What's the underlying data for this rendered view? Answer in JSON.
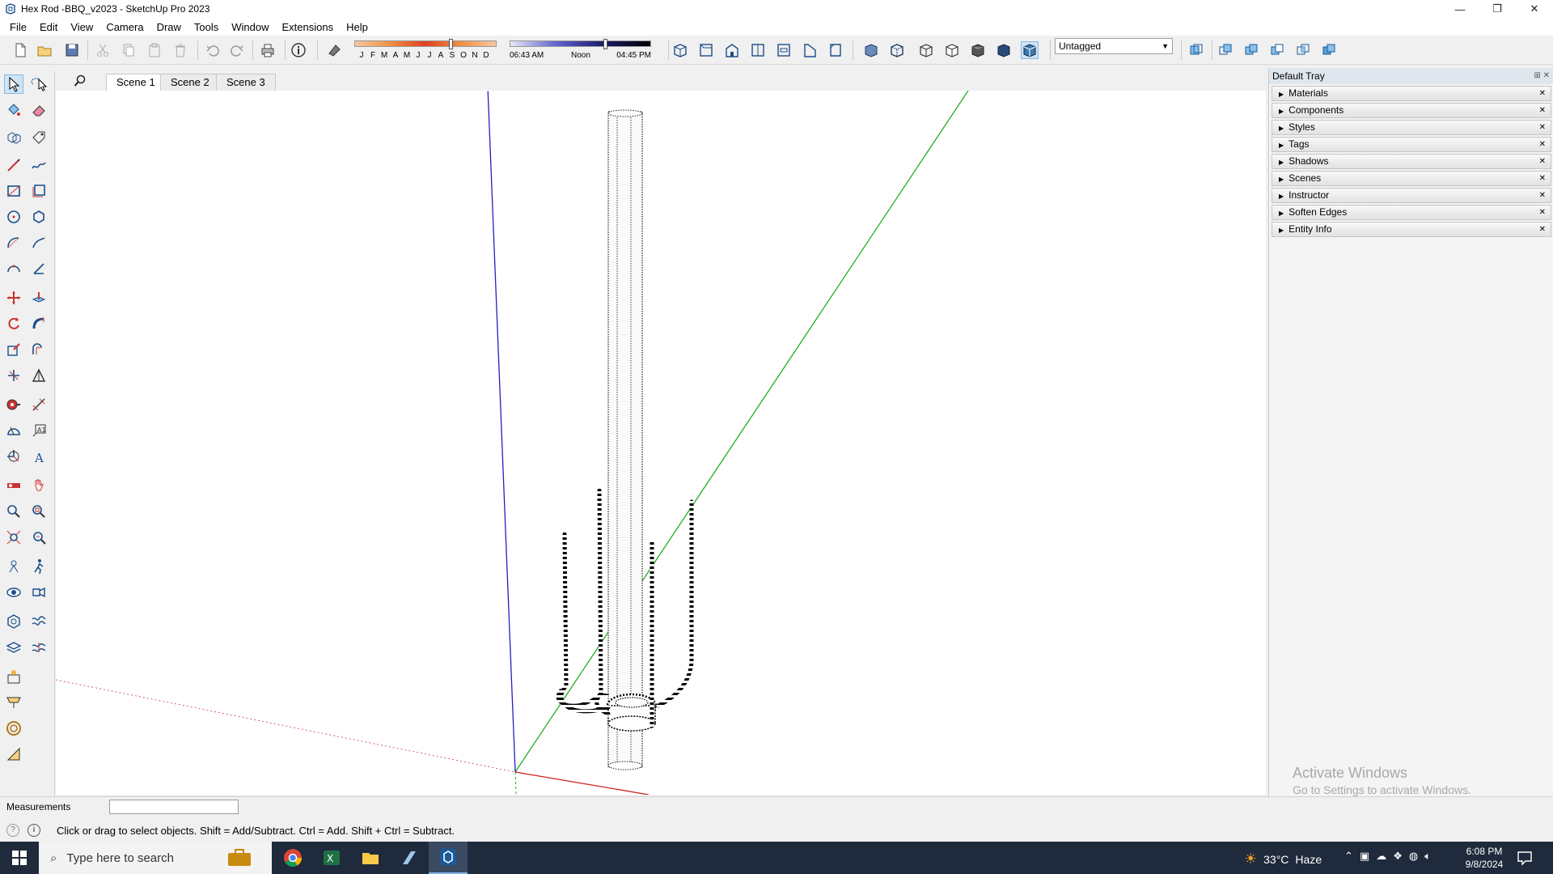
{
  "window": {
    "title": "Hex Rod -BBQ_v2023 - SketchUp Pro 2023",
    "minimize": "—",
    "restore": "❐",
    "close": "✕"
  },
  "menu": [
    "File",
    "Edit",
    "View",
    "Camera",
    "Draw",
    "Tools",
    "Window",
    "Extensions",
    "Help"
  ],
  "shadow": {
    "months": [
      "J",
      "F",
      "M",
      "A",
      "M",
      "J",
      "J",
      "A",
      "S",
      "O",
      "N",
      "D"
    ],
    "time_start": "06:43 AM",
    "time_noon": "Noon",
    "time_end": "04:45 PM",
    "month_position": 0.68,
    "time_position": 0.68
  },
  "tag_selector": {
    "value": "Untagged"
  },
  "scenes": [
    "Scene 1",
    "Scene 2",
    "Scene 3"
  ],
  "tray": {
    "title": "Default Tray",
    "panels": [
      "Materials",
      "Components",
      "Styles",
      "Tags",
      "Shadows",
      "Scenes",
      "Instructor",
      "Soften Edges",
      "Entity Info"
    ]
  },
  "watermark": {
    "line1": "Activate Windows",
    "line2": "Go to Settings to activate Windows."
  },
  "measurements": {
    "label": "Measurements",
    "value": ""
  },
  "status": {
    "message": "Click or drag to select objects. Shift = Add/Subtract. Ctrl = Add. Shift + Ctrl = Subtract."
  },
  "taskbar": {
    "search_placeholder": "Type here to search",
    "weather_temp": "33°C",
    "weather_desc": "Haze",
    "time": "6:08 PM",
    "date": "9/8/2024"
  },
  "colors": {
    "axis_red": "#d02020",
    "axis_green": "#20b020",
    "axis_blue": "#2020c0",
    "taskbar_bg": "#1f2a3c",
    "selection_highlight": "#cde4f7"
  }
}
